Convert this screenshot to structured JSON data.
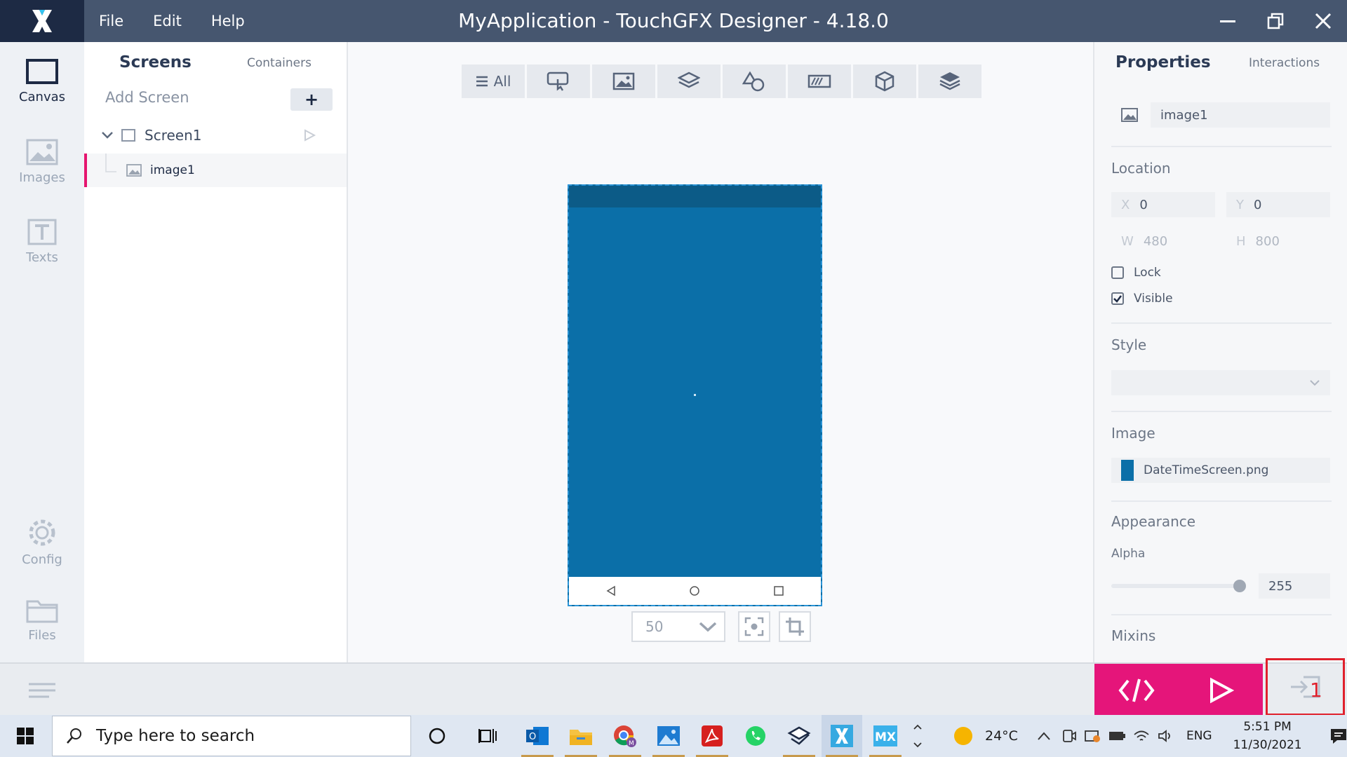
{
  "window": {
    "title": "MyApplication - TouchGFX Designer - 4.18.0",
    "menu": [
      "File",
      "Edit",
      "Help"
    ]
  },
  "leftnav": {
    "items": [
      {
        "label": "Canvas",
        "icon": "canvas-icon"
      },
      {
        "label": "Images",
        "icon": "images-icon"
      },
      {
        "label": "Texts",
        "icon": "texts-icon"
      },
      {
        "label": "Config",
        "icon": "gear-icon"
      },
      {
        "label": "Files",
        "icon": "folder-icon"
      }
    ]
  },
  "tree": {
    "tab_screens": "Screens",
    "tab_containers": "Containers",
    "add_screen": "Add Screen",
    "add_button": "+",
    "screen_name": "Screen1",
    "widget_name": "image1"
  },
  "toolbar": {
    "all_label": "All",
    "zoom": "50"
  },
  "properties": {
    "tab_properties": "Properties",
    "tab_interactions": "Interactions",
    "name": "image1",
    "location_title": "Location",
    "x_label": "X",
    "x_value": "0",
    "y_label": "Y",
    "y_value": "0",
    "w_label": "W",
    "w_value": "480",
    "h_label": "H",
    "h_value": "800",
    "lock_label": "Lock",
    "lock_checked": false,
    "visible_label": "Visible",
    "visible_checked": true,
    "style_title": "Style",
    "image_title": "Image",
    "image_file": "DateTimeScreen.png",
    "appearance_title": "Appearance",
    "alpha_label": "Alpha",
    "alpha_value": "255",
    "mixins_title": "Mixins"
  },
  "bottombar": {
    "badge": "1"
  },
  "taskbar": {
    "search_placeholder": "Type here to search",
    "weather": "24°C",
    "language": "ENG",
    "time": "5:51 PM",
    "date": "11/30/2021"
  },
  "colors": {
    "accent": "#e5157a",
    "titlebar": "#46566f",
    "canvas_blue": "#0b6fa8"
  }
}
